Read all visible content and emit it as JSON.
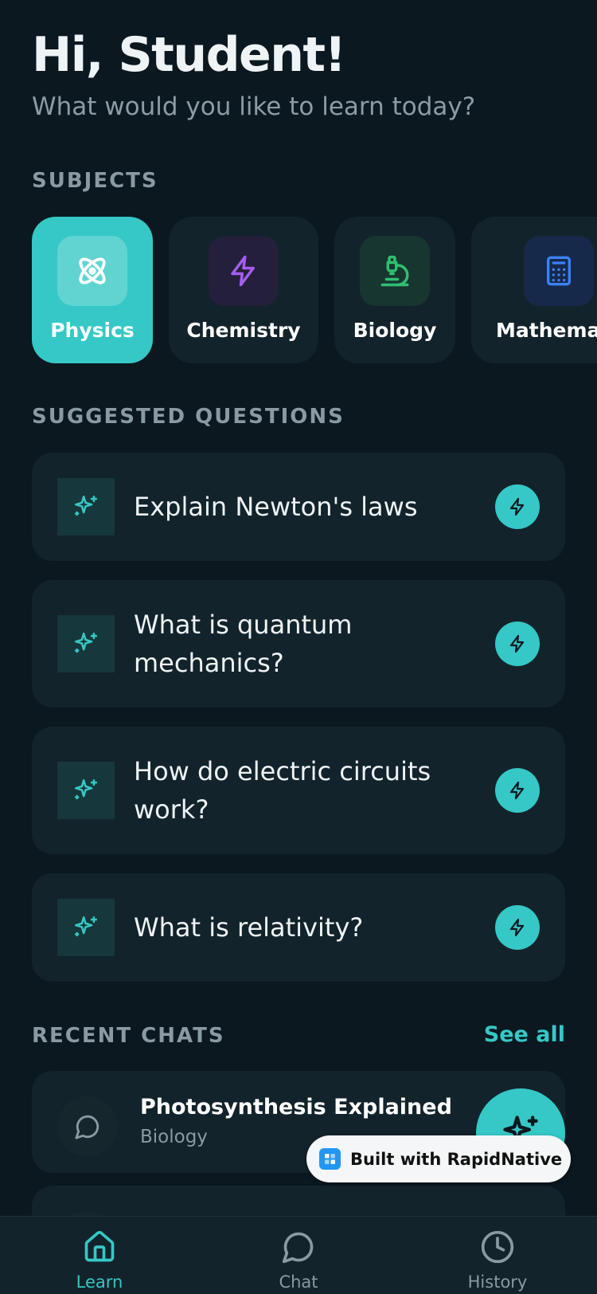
{
  "header": {
    "greeting": "Hi, Student!",
    "subtitle": "What would you like to learn today?"
  },
  "sections": {
    "subjects": "SUBJECTS",
    "suggested": "SUGGESTED QUESTIONS",
    "recent": "RECENT CHATS",
    "see_all": "See all"
  },
  "subjects": [
    {
      "name": "Physics",
      "icon": "atom-icon",
      "color": "#ffffff",
      "active": true
    },
    {
      "name": "Chemistry",
      "icon": "lightning-icon",
      "color": "#a45ef0",
      "active": false
    },
    {
      "name": "Biology",
      "icon": "microscope-icon",
      "color": "#2fbf71",
      "active": false
    },
    {
      "name": "Mathemat",
      "icon": "calculator-icon",
      "color": "#3b82f6",
      "active": false
    }
  ],
  "questions": [
    {
      "text": "Explain Newton's laws"
    },
    {
      "text": "What is quantum mechanics?"
    },
    {
      "text": "How do electric circuits work?"
    },
    {
      "text": "What is relativity?"
    }
  ],
  "recent_chats": [
    {
      "title": "Photosynthesis Explained",
      "subject": "Biology"
    }
  ],
  "badge": {
    "text": "Built with RapidNative"
  },
  "nav": [
    {
      "label": "Learn",
      "icon": "home-icon",
      "active": true
    },
    {
      "label": "Chat",
      "icon": "chat-bubble-icon",
      "active": false
    },
    {
      "label": "History",
      "icon": "clock-icon",
      "active": false
    }
  ],
  "colors": {
    "accent": "#35c8c6",
    "background": "#0b1820",
    "card": "#13232b"
  }
}
